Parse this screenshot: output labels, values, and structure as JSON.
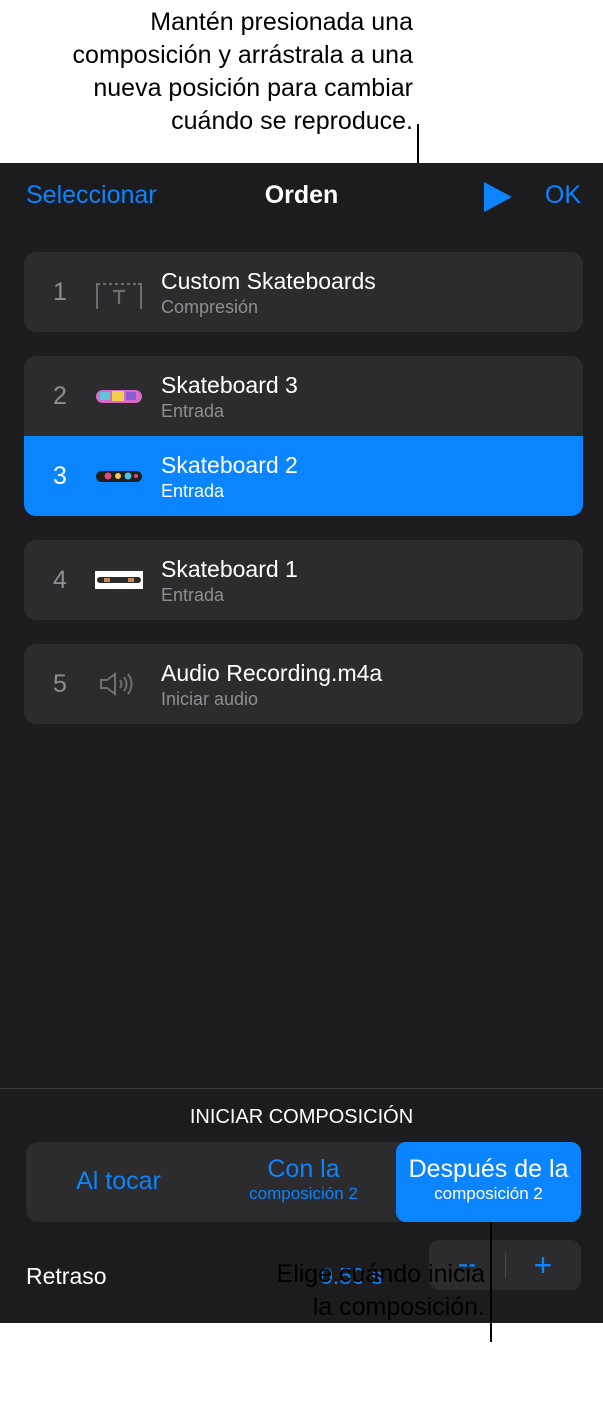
{
  "callouts": {
    "top": [
      "Mantén presionada una",
      "composición y arrástrala a una",
      "nueva posición para cambiar",
      "cuándo se reproduce."
    ],
    "bottom": [
      "Elige cuándo inicia",
      "la composición."
    ]
  },
  "nav": {
    "left": "Seleccionar",
    "title": "Orden",
    "right": "OK"
  },
  "builds": [
    {
      "number": "1",
      "title": "Custom Skateboards",
      "subtitle": "Compresión",
      "icon": "text-box-icon"
    },
    {
      "number": "2",
      "title": "Skateboard 3",
      "subtitle": "Entrada",
      "icon": "skateboard-thumb-icon"
    },
    {
      "number": "3",
      "title": "Skateboard 2",
      "subtitle": "Entrada",
      "icon": "skateboard-thumb-icon"
    },
    {
      "number": "4",
      "title": "Skateboard 1",
      "subtitle": "Entrada",
      "icon": "skateboard-thumb-icon"
    },
    {
      "number": "5",
      "title": "Audio Recording.m4a",
      "subtitle": "Iniciar audio",
      "icon": "speaker-icon"
    }
  ],
  "start": {
    "header": "INICIAR COMPOSICIÓN",
    "options": [
      {
        "line1": "Al tocar",
        "line2": ""
      },
      {
        "line1": "Con la",
        "line2": "composición 2"
      },
      {
        "line1": "Después de la",
        "line2": "composición 2"
      }
    ],
    "selected_option": 2
  },
  "delay": {
    "label": "Retraso",
    "value": "0.50 s",
    "minus": "−",
    "plus": "+"
  },
  "colors": {
    "accent": "#0a84ff",
    "panel": "#1c1c1e",
    "row": "#2c2c2e"
  }
}
